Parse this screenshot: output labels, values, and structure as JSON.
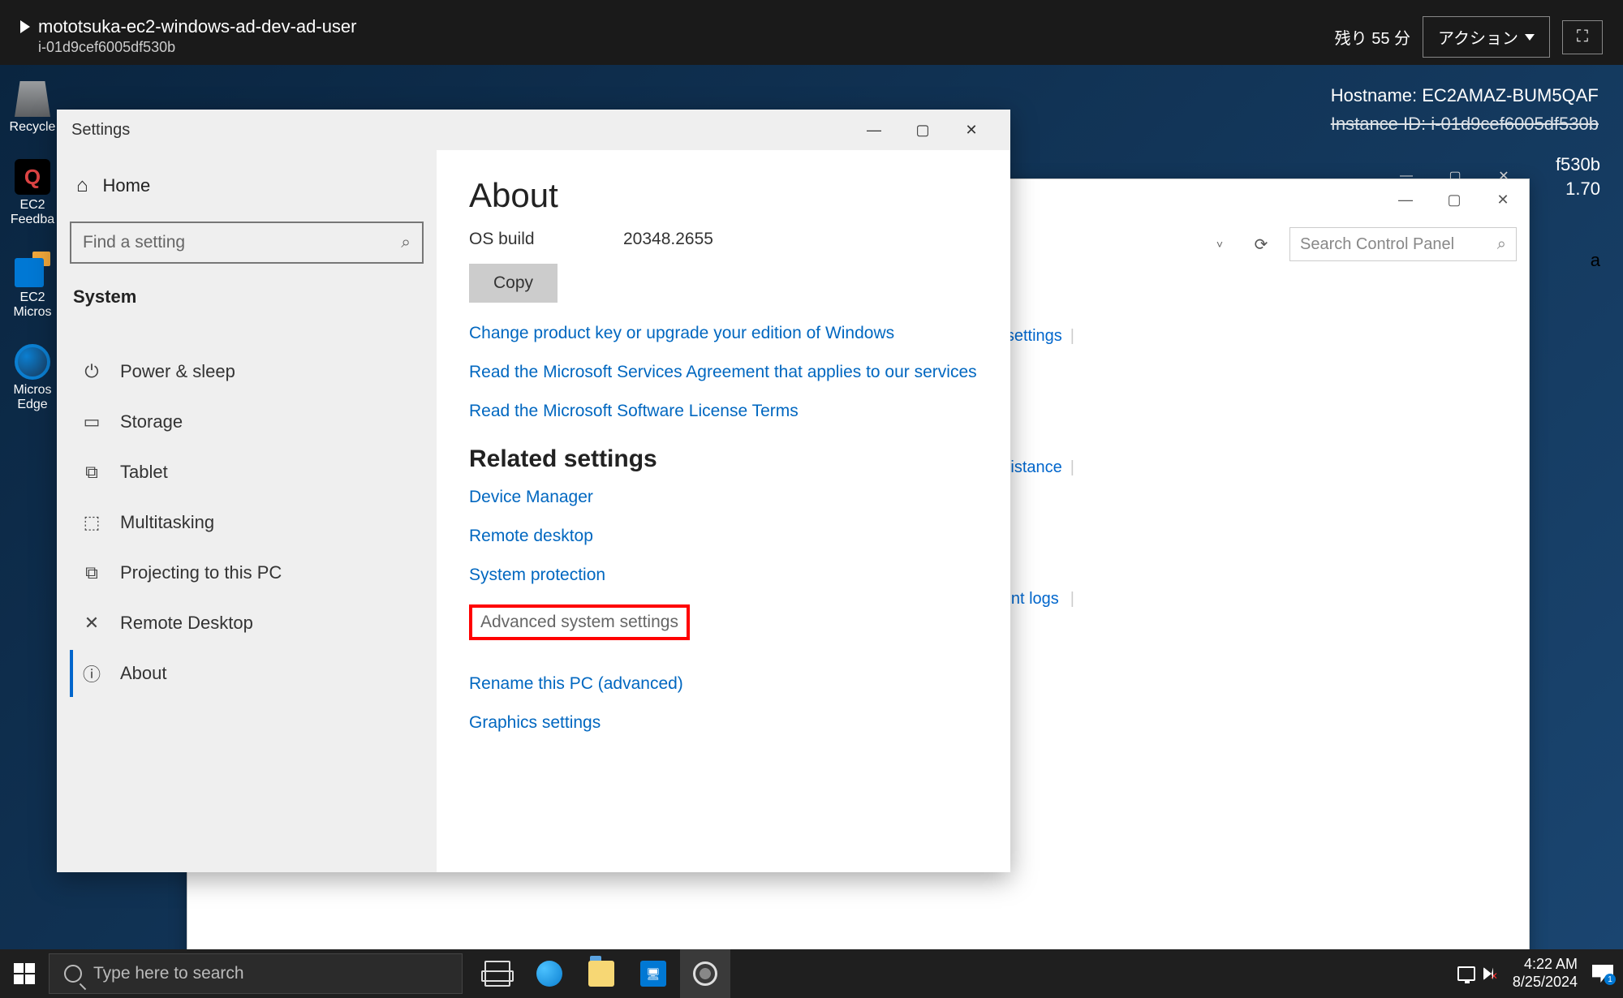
{
  "header": {
    "title": "mototsuka-ec2-windows-ad-dev-ad-user",
    "instance_id": "i-01d9cef6005df530b",
    "remaining_label": "残り 55 分",
    "action_button": "アクション"
  },
  "desktop_info": {
    "hostname_label": "Hostname: EC2AMAZ-BUM5QAF",
    "instance_label": "Instance ID: i-01d9cef6005df530b",
    "version_partial": "1.70",
    "trailing_530b": "f530b",
    "letter_a": "a"
  },
  "desktop_icons": {
    "recycle": "Recycle",
    "ec2_feedback": "EC2 Feedba",
    "ec2_micros": "EC2 Micros",
    "edge": "Micros Edge"
  },
  "control_panel": {
    "search_placeholder": "Search Control Panel",
    "link1": "ntrol settings",
    "link2": "remote assistance",
    "link3": "View event logs",
    "link3_suffix_s": "s"
  },
  "settings": {
    "window_title": "Settings",
    "home": "Home",
    "search_placeholder": "Find a setting",
    "category": "System",
    "sidebar": [
      {
        "icon": "power-icon",
        "glyph": "⏻",
        "label": "Power & sleep"
      },
      {
        "icon": "storage-icon",
        "glyph": "▭",
        "label": "Storage"
      },
      {
        "icon": "tablet-icon",
        "glyph": "⧉",
        "label": "Tablet"
      },
      {
        "icon": "multitasking-icon",
        "glyph": "⬚",
        "label": "Multitasking"
      },
      {
        "icon": "projecting-icon",
        "glyph": "⧉",
        "label": "Projecting to this PC"
      },
      {
        "icon": "remote-desktop-icon",
        "glyph": "✕",
        "label": "Remote Desktop"
      },
      {
        "icon": "about-icon",
        "glyph": "ⓘ",
        "label": "About"
      }
    ],
    "main": {
      "heading": "About",
      "os_build_label": "OS build",
      "os_build_value": "20348.2655",
      "copy_button": "Copy",
      "link_change_key": "Change product key or upgrade your edition of Windows",
      "link_services_agreement": "Read the Microsoft Services Agreement that applies to our services",
      "link_license_terms": "Read the Microsoft Software License Terms",
      "related_heading": "Related settings",
      "link_device_manager": "Device Manager",
      "link_remote_desktop": "Remote desktop",
      "link_system_protection": "System protection",
      "link_advanced": "Advanced system settings",
      "link_rename": "Rename this PC (advanced)",
      "link_graphics": "Graphics settings"
    }
  },
  "taskbar": {
    "search_placeholder": "Type here to search",
    "time": "4:22 AM",
    "date": "8/25/2024",
    "notif_count": "1"
  }
}
